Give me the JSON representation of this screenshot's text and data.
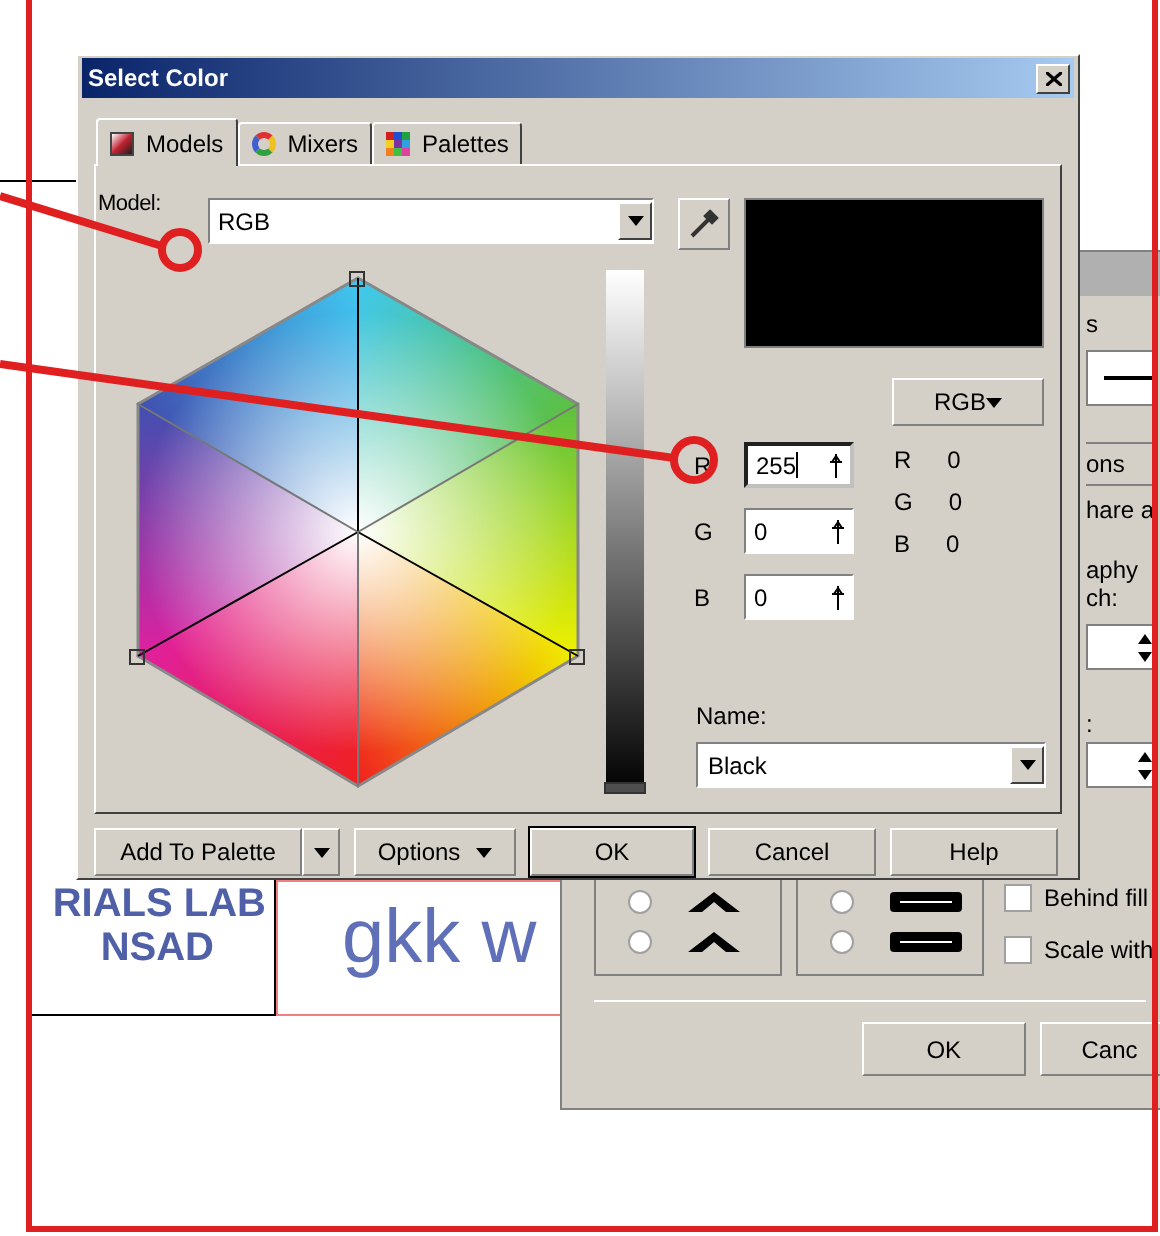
{
  "document": {
    "lab_title": "RIALS LAB",
    "lab_subtitle": "NSAD",
    "outline_text": "gkk w"
  },
  "back_dialog": {
    "fragments": [
      "s",
      "ons",
      "hare a",
      "aphy",
      "ch:",
      ":"
    ],
    "options": [
      {
        "label": "Behind fill",
        "checked": false
      },
      {
        "label": "Scale with",
        "checked": false
      }
    ],
    "radio_groups": [
      {
        "kind": "arrowhead",
        "radios": [
          {
            "selected": false
          },
          {
            "selected": false
          }
        ]
      },
      {
        "kind": "line_end",
        "radios": [
          {
            "selected": false
          },
          {
            "selected": false
          }
        ]
      }
    ],
    "buttons": [
      "OK",
      "Canc"
    ]
  },
  "select_color": {
    "title": "Select Color",
    "tabs": [
      {
        "label": "Models",
        "selected": true,
        "kind": "models"
      },
      {
        "label": "Mixers",
        "selected": false,
        "kind": "mixers"
      },
      {
        "label": "Palettes",
        "selected": false,
        "kind": "palettes"
      }
    ],
    "model_label": "Model:",
    "model_value": "RGB",
    "brightness": {
      "level": 0
    },
    "readout_model": "RGB",
    "channels": [
      {
        "label": "R",
        "value": "255",
        "focused": true,
        "readout_label": "R",
        "readout_value": "0"
      },
      {
        "label": "G",
        "value": "0",
        "focused": false,
        "readout_label": "G",
        "readout_value": "0"
      },
      {
        "label": "B",
        "value": "0",
        "focused": false,
        "readout_label": "B",
        "readout_value": "0"
      }
    ],
    "name_label": "Name:",
    "name_value": "Black",
    "buttons": [
      {
        "label": "Add To Palette",
        "kind": "split"
      },
      {
        "label": "Options",
        "kind": "menu"
      },
      {
        "label": "OK",
        "kind": "default"
      },
      {
        "label": "Cancel",
        "kind": "plain"
      },
      {
        "label": "Help",
        "kind": "plain"
      }
    ]
  }
}
